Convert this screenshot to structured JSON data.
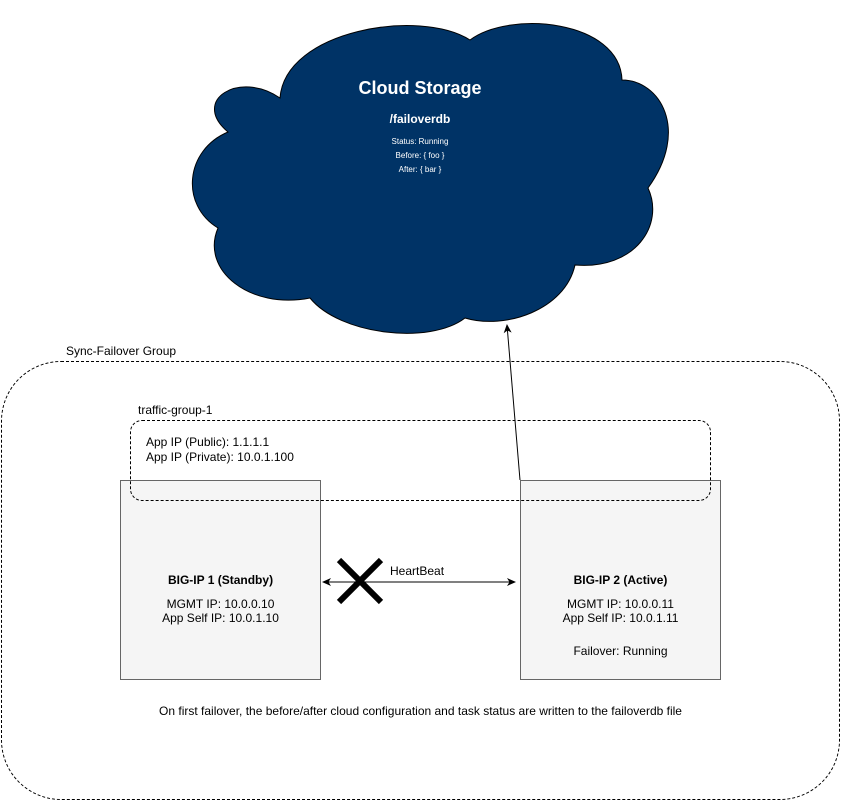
{
  "cloud": {
    "title": "Cloud Storage",
    "path": "/failoverdb",
    "status": "Status: Running",
    "before": "Before: { foo }",
    "after": "After: { bar }",
    "fill": "#003366"
  },
  "sync_group": {
    "label": "Sync-Failover Group"
  },
  "traffic_group": {
    "label": "traffic-group-1",
    "app_ip_public": "App IP (Public): 1.1.1.1",
    "app_ip_private": "App IP (Private): 10.0.1.100"
  },
  "bigip1": {
    "title": "BIG-IP 1 (Standby)",
    "mgmt_ip": "MGMT IP: 10.0.0.10",
    "self_ip": "App Self IP: 10.0.1.10"
  },
  "bigip2": {
    "title": "BIG-IP 2 (Active)",
    "mgmt_ip": "MGMT IP: 10.0.0.11",
    "self_ip": "App Self IP: 10.0.1.11",
    "failover": "Failover: Running"
  },
  "heartbeat": {
    "label": "HeartBeat"
  },
  "note": "On first failover, the before/after cloud configuration and task status are written to the failoverdb file"
}
